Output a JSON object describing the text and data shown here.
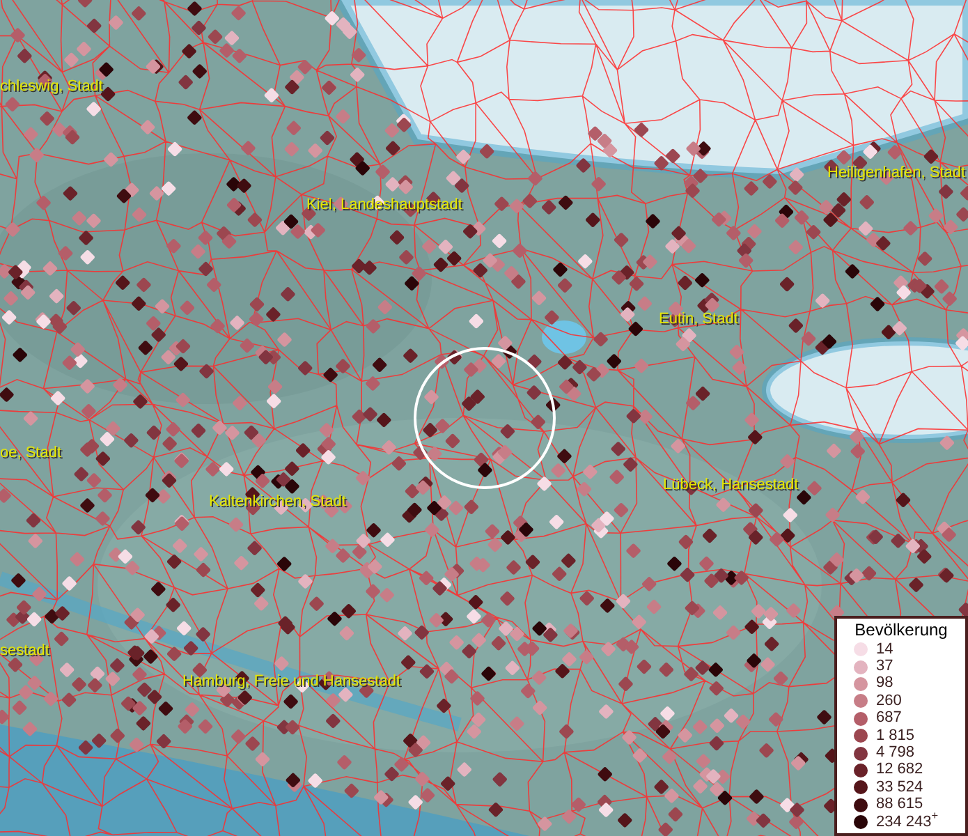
{
  "map_labels": [
    {
      "text": "chleswig, Stadt"
    },
    {
      "text": "Kiel, Landeshauptstadt"
    },
    {
      "text": "Heiligenhafen, Stadt"
    },
    {
      "text": "Eutin, Stadt"
    },
    {
      "text": "oe, Stadt"
    },
    {
      "text": "Kaltenkirchen, Stadt"
    },
    {
      "text": "Lübeck, Hansestadt"
    },
    {
      "text": "sestadt"
    },
    {
      "text": "Hamburg, Freie und Hansestadt"
    }
  ],
  "legend": {
    "title": "Bevölkerung",
    "items": [
      {
        "label": "14",
        "color": "#f6dde6"
      },
      {
        "label": "37",
        "color": "#e3b3bf"
      },
      {
        "label": "98",
        "color": "#d5959f"
      },
      {
        "label": "260",
        "color": "#c77d87"
      },
      {
        "label": "687",
        "color": "#b45e69"
      },
      {
        "label": "1 815",
        "color": "#9c4750"
      },
      {
        "label": "4 798",
        "color": "#823540"
      },
      {
        "label": "12 682",
        "color": "#6a2229"
      },
      {
        "label": "33 524",
        "color": "#55151a"
      },
      {
        "label": "88 615",
        "color": "#3f0c10"
      },
      {
        "label": "234 243$^{+}$",
        "color": "#2a0508"
      }
    ]
  }
}
